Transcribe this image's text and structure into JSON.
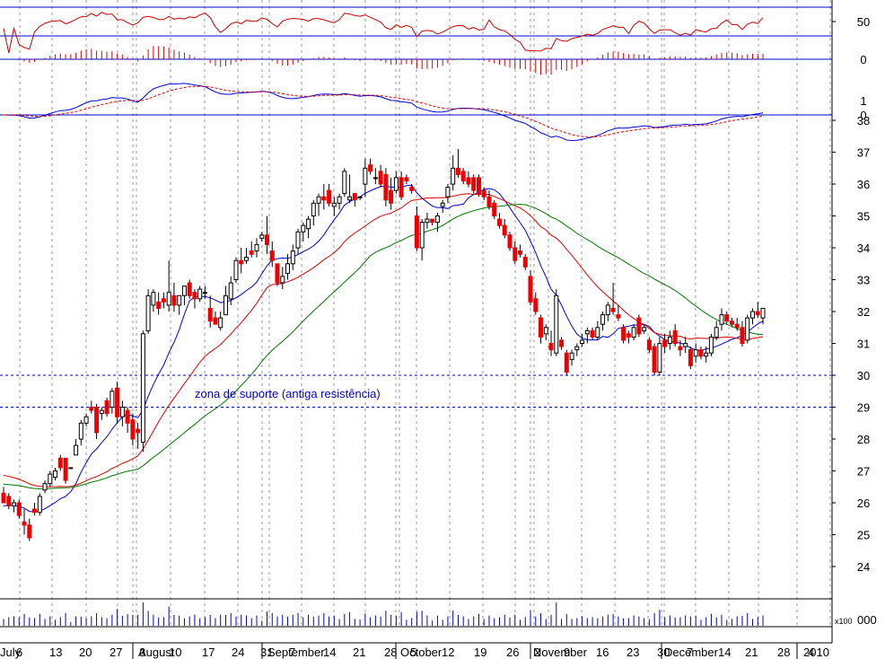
{
  "chart_data": {
    "type": "candlestick",
    "title": "",
    "annotation": "zona de suporte (antiga resistência)",
    "x_date_labels": [
      "July",
      "6",
      "13",
      "20",
      "27",
      "3",
      "August",
      "10",
      "17",
      "24",
      "31",
      "September",
      "7",
      "14",
      "21",
      "28",
      "5",
      "October",
      "12",
      "19",
      "26",
      "2",
      "November",
      "9",
      "16",
      "23",
      "30",
      "December",
      "7",
      "14",
      "21",
      "28",
      "4",
      "2010"
    ],
    "price_axis": {
      "ylim": [
        23.6,
        38.5
      ],
      "ticks": [
        24,
        25,
        26,
        27,
        28,
        29,
        30,
        31,
        32,
        33,
        34,
        35,
        36,
        37,
        38
      ]
    },
    "support_levels": [
      30,
      29
    ],
    "oscillator_panel": {
      "ticks": [
        50
      ],
      "bands": [
        70,
        30
      ]
    },
    "histogram_panel": {
      "ticks": [
        0
      ]
    },
    "macd_panel": {
      "ticks": [
        1,
        0
      ]
    },
    "volume_panel": {
      "multiplier_label": "x100",
      "tick_label": "000"
    },
    "colors": {
      "up": "#ffffff",
      "down": "#ee0000",
      "ma_short": "#0000dd",
      "ma_mid": "#dd0000",
      "ma_long": "#007700",
      "support": "#0000cc",
      "grid": "#999999"
    },
    "candles": [
      [
        26.3,
        26.5,
        26.0,
        26.0
      ],
      [
        26.2,
        26.3,
        25.8,
        25.9
      ],
      [
        25.9,
        26.1,
        25.7,
        26.0
      ],
      [
        26.0,
        26.1,
        25.5,
        25.6
      ],
      [
        25.4,
        25.8,
        25.0,
        25.3
      ],
      [
        25.3,
        25.5,
        24.8,
        24.9
      ],
      [
        25.8,
        26.0,
        25.6,
        25.7
      ],
      [
        25.7,
        26.3,
        25.6,
        26.2
      ],
      [
        26.4,
        26.7,
        26.3,
        26.6
      ],
      [
        26.6,
        27.0,
        26.5,
        26.9
      ],
      [
        26.8,
        27.1,
        26.7,
        27.0
      ],
      [
        27.4,
        27.5,
        27.0,
        27.1
      ],
      [
        27.4,
        27.4,
        26.6,
        26.7
      ],
      [
        27.1,
        27.1,
        27.1,
        27.1
      ],
      [
        27.5,
        28.0,
        27.5,
        27.8
      ],
      [
        28.0,
        28.6,
        27.8,
        28.5
      ],
      [
        28.5,
        28.8,
        28.4,
        28.7
      ],
      [
        29.0,
        29.2,
        28.8,
        28.9
      ],
      [
        29.0,
        29.1,
        28.0,
        28.2
      ],
      [
        28.8,
        29.0,
        28.6,
        28.9
      ],
      [
        29.2,
        29.3,
        28.7,
        28.8
      ],
      [
        29.0,
        29.6,
        28.8,
        29.5
      ],
      [
        29.6,
        29.8,
        28.5,
        28.7
      ],
      [
        28.7,
        29.2,
        28.4,
        29.0
      ],
      [
        28.9,
        29.0,
        28.2,
        28.5
      ],
      [
        28.6,
        28.8,
        27.8,
        28.0
      ],
      [
        28.3,
        28.5,
        27.7,
        28.2
      ],
      [
        27.9,
        31.4,
        27.6,
        31.3
      ],
      [
        31.4,
        32.7,
        31.3,
        32.5
      ],
      [
        32.2,
        32.7,
        32.0,
        32.6
      ],
      [
        32.3,
        32.6,
        31.9,
        32.1
      ],
      [
        32.4,
        32.6,
        32.1,
        32.3
      ],
      [
        32.2,
        33.6,
        32.0,
        32.6
      ],
      [
        32.5,
        32.9,
        32.0,
        32.2
      ],
      [
        32.2,
        32.5,
        31.9,
        32.5
      ],
      [
        32.5,
        32.8,
        32.2,
        32.8
      ],
      [
        32.9,
        33.0,
        32.4,
        32.5
      ],
      [
        32.6,
        32.7,
        32.1,
        32.4
      ],
      [
        32.4,
        32.8,
        32.3,
        32.7
      ],
      [
        32.6,
        32.8,
        32.4,
        32.6
      ],
      [
        32.1,
        32.5,
        31.5,
        31.7
      ],
      [
        31.8,
        32.0,
        31.6,
        31.6
      ],
      [
        31.5,
        32.0,
        31.4,
        31.8
      ],
      [
        31.9,
        32.8,
        31.9,
        32.5
      ],
      [
        32.4,
        33.1,
        32.2,
        32.9
      ],
      [
        33.0,
        33.7,
        32.9,
        33.6
      ],
      [
        33.6,
        34.0,
        33.2,
        33.5
      ],
      [
        33.6,
        34.0,
        33.5,
        33.7
      ],
      [
        33.9,
        34.2,
        33.7,
        33.8
      ],
      [
        33.9,
        34.3,
        33.7,
        34.1
      ],
      [
        34.3,
        34.5,
        34.2,
        34.4
      ],
      [
        34.4,
        35.0,
        33.8,
        34.1
      ],
      [
        33.9,
        34.2,
        33.4,
        33.6
      ],
      [
        33.5,
        33.5,
        32.8,
        32.9
      ],
      [
        32.9,
        33.4,
        32.7,
        33.1
      ],
      [
        33.2,
        33.8,
        33.0,
        33.5
      ],
      [
        33.5,
        34.1,
        33.3,
        33.9
      ],
      [
        34.0,
        34.6,
        33.8,
        34.5
      ],
      [
        34.5,
        34.8,
        34.2,
        34.7
      ],
      [
        34.6,
        35.0,
        34.3,
        34.9
      ],
      [
        35.0,
        35.5,
        34.7,
        35.4
      ],
      [
        35.4,
        35.7,
        35.0,
        35.6
      ],
      [
        35.6,
        36.0,
        35.2,
        35.5
      ],
      [
        35.8,
        36.0,
        35.3,
        35.4
      ],
      [
        35.3,
        35.6,
        35.0,
        35.4
      ],
      [
        35.4,
        35.7,
        35.2,
        35.6
      ],
      [
        35.7,
        36.5,
        35.6,
        36.4
      ],
      [
        35.5,
        36.3,
        35.4,
        35.6
      ],
      [
        35.7,
        35.7,
        35.3,
        35.5
      ],
      [
        35.6,
        35.6,
        35.5,
        35.6
      ],
      [
        36.0,
        36.8,
        35.6,
        36.5
      ],
      [
        36.6,
        36.8,
        36.3,
        36.4
      ],
      [
        36.2,
        36.5,
        36.0,
        36.2
      ],
      [
        36.4,
        36.6,
        35.9,
        36.0
      ],
      [
        36.3,
        36.5,
        35.3,
        35.5
      ],
      [
        35.8,
        36.2,
        35.2,
        35.4
      ],
      [
        35.8,
        36.4,
        35.7,
        36.2
      ],
      [
        36.2,
        36.4,
        35.5,
        35.6
      ],
      [
        36.2,
        36.3,
        36.0,
        36.1
      ],
      [
        35.9,
        36.0,
        35.7,
        35.8
      ],
      [
        35.0,
        35.3,
        33.9,
        34.0
      ],
      [
        34.0,
        34.9,
        33.6,
        34.8
      ],
      [
        34.8,
        35.1,
        34.6,
        34.9
      ],
      [
        34.9,
        34.9,
        34.7,
        34.8
      ],
      [
        34.8,
        35.1,
        34.5,
        35.0
      ],
      [
        35.3,
        35.5,
        35.1,
        35.4
      ],
      [
        35.6,
        36.0,
        35.4,
        35.9
      ],
      [
        36.0,
        36.9,
        35.8,
        36.5
      ],
      [
        36.5,
        37.1,
        36.2,
        36.3
      ],
      [
        36.4,
        36.5,
        36.0,
        36.1
      ],
      [
        36.2,
        36.4,
        35.9,
        36.0
      ],
      [
        36.2,
        36.3,
        35.7,
        35.8
      ],
      [
        36.2,
        36.3,
        35.6,
        35.7
      ],
      [
        35.8,
        35.9,
        35.5,
        35.6
      ],
      [
        35.6,
        35.8,
        35.2,
        35.3
      ],
      [
        35.4,
        35.5,
        34.9,
        35.0
      ],
      [
        34.9,
        35.1,
        34.6,
        34.7
      ],
      [
        34.7,
        34.9,
        34.3,
        34.4
      ],
      [
        34.4,
        34.5,
        33.9,
        34.0
      ],
      [
        34.0,
        34.2,
        33.5,
        33.6
      ],
      [
        33.9,
        34.1,
        33.7,
        33.8
      ],
      [
        33.7,
        33.8,
        33.3,
        33.4
      ],
      [
        33.1,
        33.3,
        32.2,
        32.3
      ],
      [
        32.4,
        32.6,
        31.9,
        32.0
      ],
      [
        31.8,
        31.9,
        31.0,
        31.2
      ],
      [
        31.3,
        31.6,
        31.1,
        31.5
      ],
      [
        31.0,
        31.4,
        30.6,
        30.8
      ],
      [
        30.7,
        32.7,
        30.6,
        32.5
      ],
      [
        31.1,
        31.2,
        30.8,
        30.9
      ],
      [
        30.7,
        30.8,
        30.0,
        30.1
      ],
      [
        30.5,
        30.8,
        30.3,
        30.7
      ],
      [
        30.8,
        31.0,
        30.6,
        30.9
      ],
      [
        31.0,
        31.3,
        30.9,
        31.1
      ],
      [
        31.3,
        31.5,
        31.0,
        31.4
      ],
      [
        31.4,
        31.5,
        31.1,
        31.2
      ],
      [
        31.2,
        31.7,
        31.1,
        31.5
      ],
      [
        31.6,
        32.0,
        31.4,
        31.9
      ],
      [
        31.9,
        32.3,
        31.7,
        32.2
      ],
      [
        32.1,
        32.9,
        31.9,
        32.0
      ],
      [
        31.9,
        32.2,
        31.7,
        31.8
      ],
      [
        31.5,
        31.6,
        31.0,
        31.1
      ],
      [
        31.3,
        31.4,
        31.0,
        31.2
      ],
      [
        31.2,
        31.6,
        31.1,
        31.5
      ],
      [
        31.8,
        31.9,
        31.2,
        31.3
      ],
      [
        31.4,
        31.6,
        31.3,
        31.5
      ],
      [
        31.1,
        31.2,
        30.7,
        30.8
      ],
      [
        30.9,
        31.0,
        30.0,
        30.1
      ],
      [
        30.1,
        31.2,
        30.0,
        31.0
      ],
      [
        31.1,
        31.3,
        30.7,
        30.9
      ],
      [
        31.0,
        31.4,
        30.8,
        31.2
      ],
      [
        31.4,
        31.6,
        30.9,
        31.0
      ],
      [
        30.9,
        31.1,
        30.6,
        30.8
      ],
      [
        30.9,
        31.2,
        30.7,
        31.0
      ],
      [
        30.8,
        30.9,
        30.2,
        30.3
      ],
      [
        30.6,
        31.0,
        30.4,
        30.8
      ],
      [
        30.8,
        30.9,
        30.5,
        30.6
      ],
      [
        30.6,
        30.9,
        30.4,
        30.7
      ],
      [
        30.7,
        31.3,
        30.6,
        31.2
      ],
      [
        31.2,
        31.7,
        31.1,
        31.5
      ],
      [
        31.6,
        32.1,
        31.4,
        31.9
      ],
      [
        31.9,
        32.0,
        31.6,
        31.7
      ],
      [
        31.7,
        31.8,
        31.5,
        31.6
      ],
      [
        31.6,
        31.8,
        31.4,
        31.5
      ],
      [
        31.5,
        31.7,
        30.9,
        31.0
      ],
      [
        31.1,
        31.9,
        31.0,
        31.8
      ],
      [
        31.8,
        32.1,
        31.6,
        32.0
      ],
      [
        32.0,
        32.3,
        31.8,
        31.9
      ],
      [
        31.8,
        32.1,
        31.6,
        32.1
      ]
    ]
  }
}
